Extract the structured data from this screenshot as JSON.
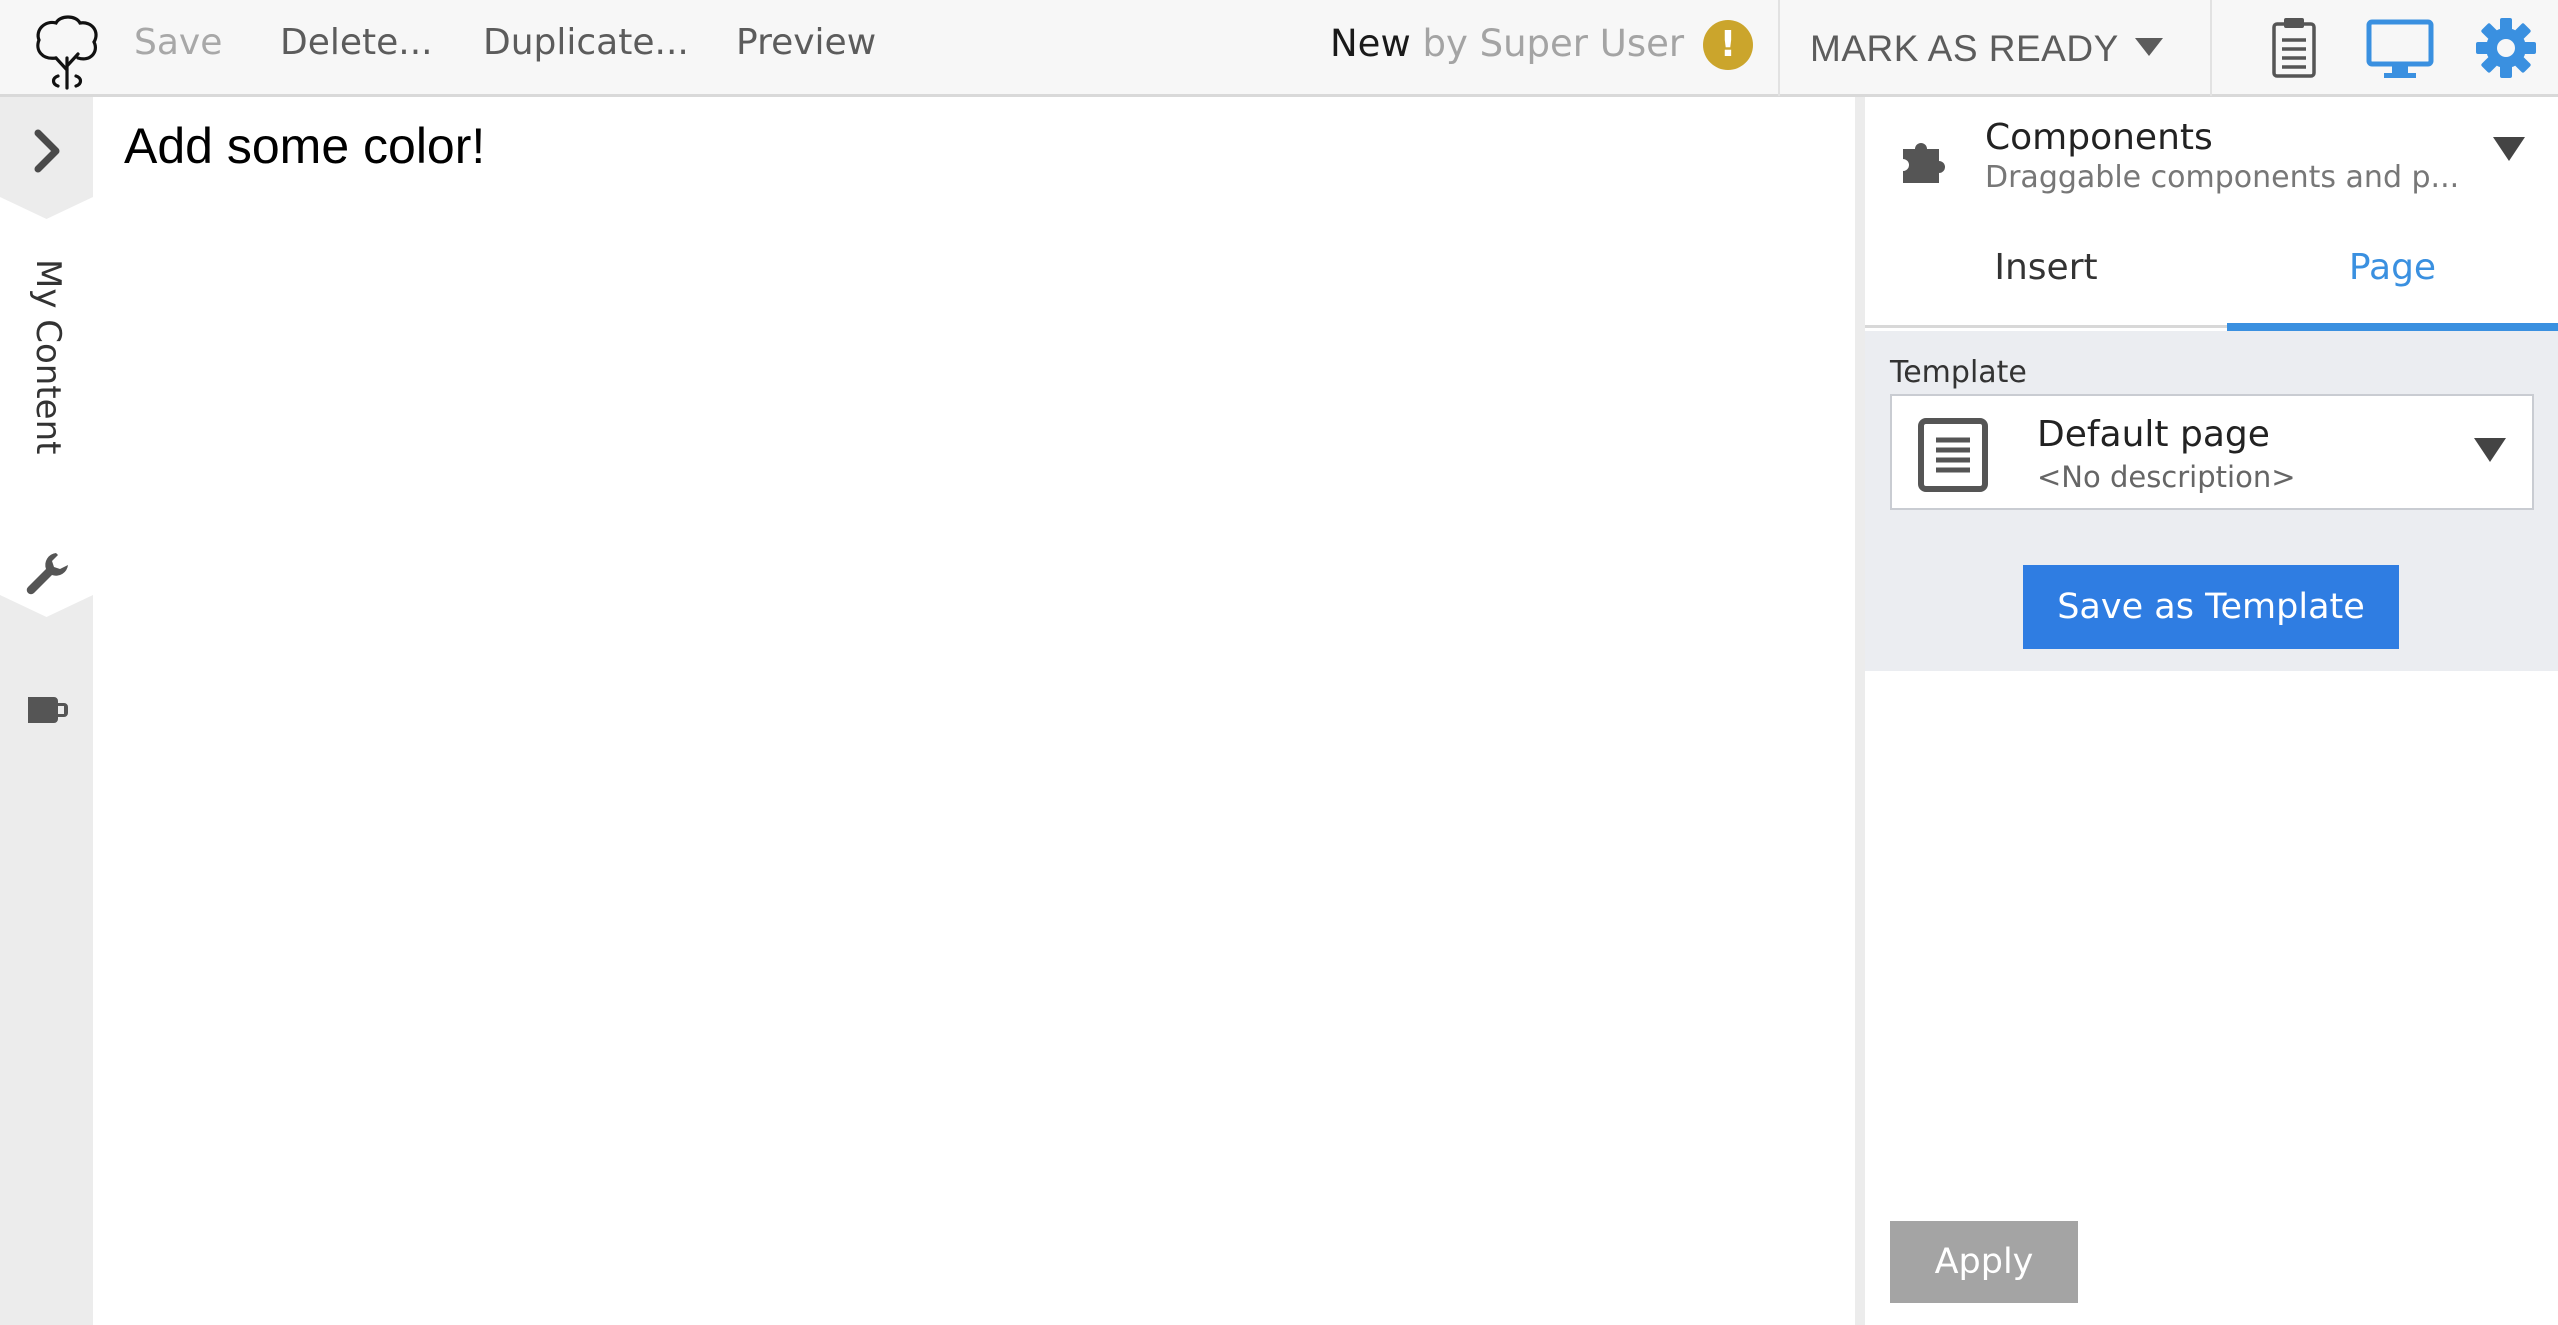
{
  "toolbar": {
    "save_label": "Save",
    "delete_label": "Delete...",
    "duplicate_label": "Duplicate...",
    "preview_label": "Preview",
    "status_state": "New",
    "status_by": "by Super User",
    "warning_glyph": "!",
    "mark_ready_label": "MARK AS READY",
    "icons": [
      "tree-logo-icon",
      "warning-icon",
      "clipboard-icon",
      "monitor-icon",
      "gear-icon"
    ]
  },
  "leftrail": {
    "tab_label": "My Content",
    "icons": [
      "chevron-right-icon",
      "wrench-icon",
      "tag-icon"
    ]
  },
  "canvas": {
    "headline": "Add some color!"
  },
  "panel": {
    "title": "Components",
    "subtitle": "Draggable components and p...",
    "tabs": [
      {
        "label": "Insert",
        "active": false
      },
      {
        "label": "Page",
        "active": true
      }
    ],
    "template": {
      "label": "Template",
      "selected_name": "Default page",
      "selected_description": "<No description>"
    },
    "save_template_label": "Save as Template",
    "apply_label": "Apply"
  },
  "colors": {
    "accent": "#3a90e0",
    "primary_button": "#2f7de2",
    "warning": "#cba52c",
    "disabled_button": "#a4a4a4"
  }
}
